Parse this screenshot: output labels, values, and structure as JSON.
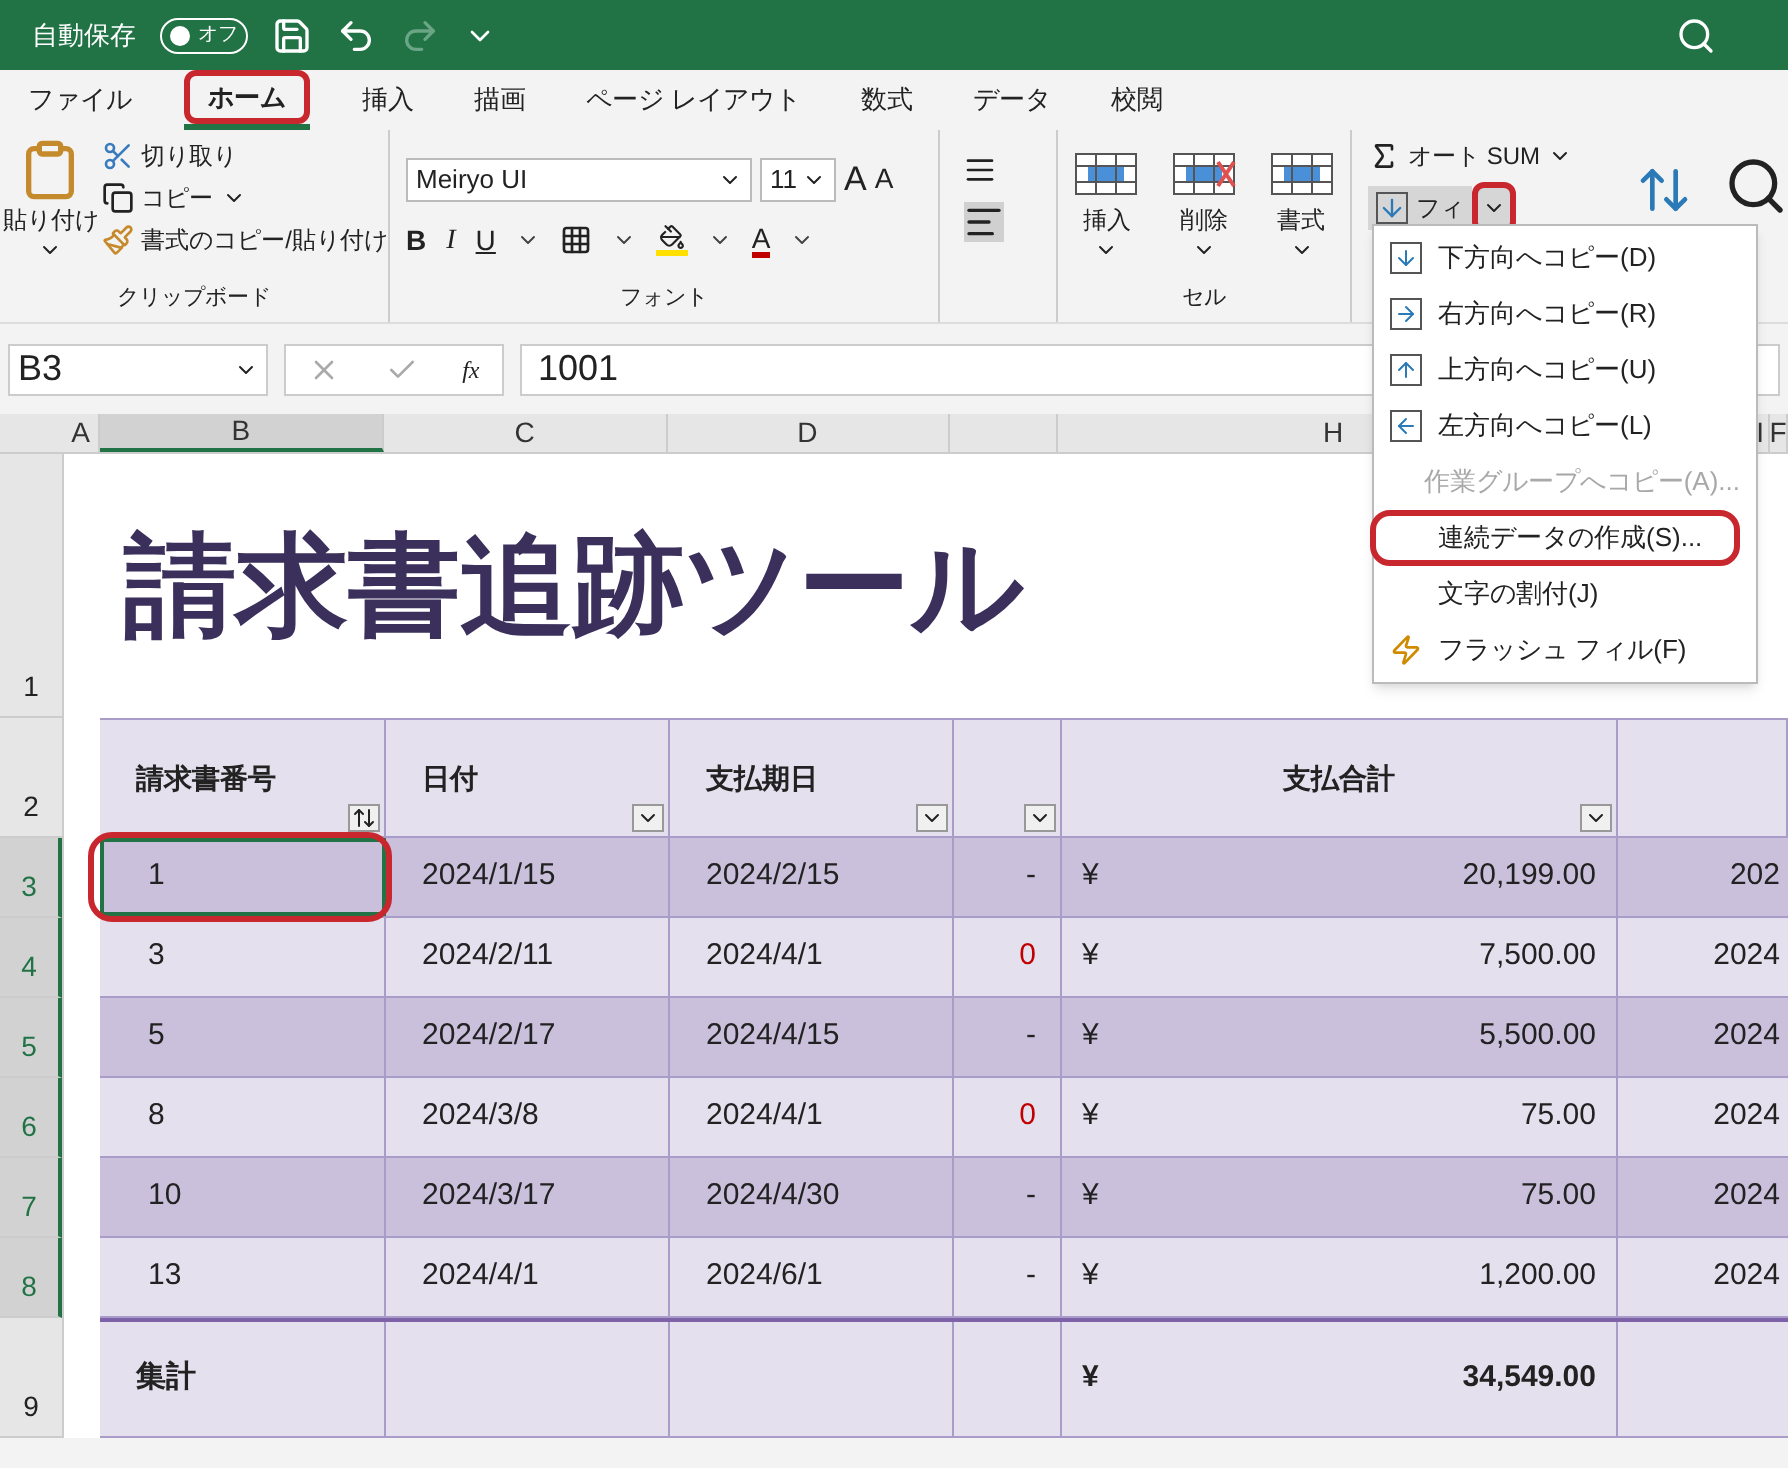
{
  "title_bar": {
    "autosave_label": "自動保存",
    "autosave_toggle": "オフ",
    "autosave_on": false
  },
  "ribbon_tabs": [
    {
      "label": "ファイル",
      "selected": false,
      "highlighted": false
    },
    {
      "label": "ホーム",
      "selected": true,
      "highlighted": true
    },
    {
      "label": "挿入",
      "selected": false,
      "highlighted": false
    },
    {
      "label": "描画",
      "selected": false,
      "highlighted": false
    },
    {
      "label": "ページ レイアウト",
      "selected": false,
      "highlighted": false
    },
    {
      "label": "数式",
      "selected": false,
      "highlighted": false
    },
    {
      "label": "データ",
      "selected": false,
      "highlighted": false
    },
    {
      "label": "校閲",
      "selected": false,
      "highlighted": false
    }
  ],
  "clipboard": {
    "paste": "貼り付け",
    "cut": "切り取り",
    "copy": "コピー",
    "format_painter": "書式のコピー/貼り付け",
    "group_label": "クリップボード"
  },
  "font": {
    "font_name": "Meiryo UI",
    "font_size": "11",
    "grow": "A",
    "shrink": "A",
    "bold": "B",
    "italic": "I",
    "underline": "U",
    "font_color": "A",
    "group_label": "フォント"
  },
  "cells": {
    "insert": "挿入",
    "delete": "削除",
    "format": "書式",
    "group_label": "セル"
  },
  "editing": {
    "autosum": "オート SUM",
    "fill": "フィ",
    "fill_caret_highlighted": true
  },
  "formula_bar": {
    "name_box": "B3",
    "fx": "fx",
    "value": "1001"
  },
  "column_headers": [
    {
      "label": "A",
      "selected": false
    },
    {
      "label": "B",
      "selected": true
    },
    {
      "label": "C",
      "selected": false
    },
    {
      "label": "D",
      "selected": false
    },
    {
      "label": "H",
      "selected": false
    },
    {
      "label": "I",
      "selected": false
    },
    {
      "label": "F",
      "selected": false
    }
  ],
  "row_headers": [
    {
      "label": "1",
      "selected": false
    },
    {
      "label": "2",
      "selected": false
    },
    {
      "label": "3",
      "selected": true
    },
    {
      "label": "4",
      "selected": true
    },
    {
      "label": "5",
      "selected": true
    },
    {
      "label": "6",
      "selected": true
    },
    {
      "label": "7",
      "selected": true
    },
    {
      "label": "8",
      "selected": true
    },
    {
      "label": "9",
      "selected": false
    }
  ],
  "sheet_title": "請求書追跡ツール",
  "table": {
    "columns": [
      {
        "label": "請求書番号",
        "kind": "sort"
      },
      {
        "label": "日付",
        "kind": "filter"
      },
      {
        "label": "支払期日",
        "kind": "filter"
      },
      {
        "kind": "filter"
      },
      {
        "label": "支払合計",
        "kind": "filter"
      },
      {
        "kind": "none"
      }
    ],
    "rows": [
      {
        "invoice": "1",
        "date": "2024/1/15",
        "due": "2024/2/15",
        "column_4": "-",
        "column_4_alert": false,
        "currency": "¥",
        "total": "20,199.00",
        "column_6": "202",
        "selected": true,
        "highlighted": true
      },
      {
        "invoice": "3",
        "date": "2024/2/11",
        "due": "2024/4/1",
        "column_4": "0",
        "column_4_alert": true,
        "currency": "¥",
        "total": "7,500.00",
        "column_6": "2024",
        "selected": false,
        "highlighted": false
      },
      {
        "invoice": "5",
        "date": "2024/2/17",
        "due": "2024/4/15",
        "column_4": "-",
        "column_4_alert": false,
        "currency": "¥",
        "total": "5,500.00",
        "column_6": "2024",
        "selected": false,
        "highlighted": false
      },
      {
        "invoice": "8",
        "date": "2024/3/8",
        "due": "2024/4/1",
        "column_4": "0",
        "column_4_alert": true,
        "currency": "¥",
        "total": "75.00",
        "column_6": "2024",
        "selected": false,
        "highlighted": false
      },
      {
        "invoice": "10",
        "date": "2024/3/17",
        "due": "2024/4/30",
        "column_4": "-",
        "column_4_alert": false,
        "currency": "¥",
        "total": "75.00",
        "column_6": "2024",
        "selected": false,
        "highlighted": false
      },
      {
        "invoice": "13",
        "date": "2024/4/1",
        "due": "2024/6/1",
        "column_4": "-",
        "column_4_alert": false,
        "currency": "¥",
        "total": "1,200.00",
        "column_6": "2024",
        "selected": false,
        "highlighted": false
      }
    ],
    "total_row": {
      "label": "集計",
      "currency": "¥",
      "total": "34,549.00"
    }
  },
  "fill_menu": [
    {
      "label": "下方向へコピー(D)",
      "kind": "down",
      "disabled": false,
      "highlighted": false
    },
    {
      "label": "右方向へコピー(R)",
      "kind": "right",
      "disabled": false,
      "highlighted": false
    },
    {
      "label": "上方向へコピー(U)",
      "kind": "up",
      "disabled": false,
      "highlighted": false
    },
    {
      "label": "左方向へコピー(L)",
      "kind": "left",
      "disabled": false,
      "highlighted": false
    },
    {
      "label": "作業グループへコピー(A)...",
      "kind": "none",
      "disabled": true,
      "highlighted": false
    },
    {
      "label": "連続データの作成(S)...",
      "kind": "none",
      "disabled": false,
      "highlighted": true
    },
    {
      "label": "文字の割付(J)",
      "kind": "none",
      "disabled": false,
      "highlighted": false
    },
    {
      "label": "フラッシュ フィル(F)",
      "kind": "flash",
      "disabled": false,
      "highlighted": false
    }
  ]
}
